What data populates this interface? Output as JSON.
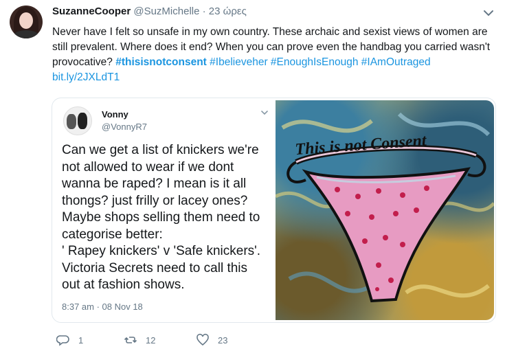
{
  "tweet": {
    "display_name": "SuzanneCooper",
    "handle": "@SuzMichelle",
    "separator": "·",
    "time": "23 ώρες",
    "text_plain": "Never have I felt so unsafe in my own country. These archaic and sexist views of women are still prevalent. Where does it end? When you can prove even the handbag you carried wasn't provocative?",
    "hashtags": [
      "#thisisnotconsent",
      "#Ibelieveher",
      "#EnoughIsEnough",
      "#IAmOutraged"
    ],
    "link": "bit.ly/2JXLdT1"
  },
  "quoted": {
    "display_name": "Vonny",
    "handle": "@VonnyR7",
    "text": "Can we get a list of knickers we're\nnot allowed to wear if we dont\nwanna be raped? I mean is it all\nthongs? just frilly or lacey ones?\nMaybe shops selling them need to\ncategorise better:\n' Rapey knickers' v 'Safe knickers'.\nVictoria Secrets need to call this\nout at fashion shows.",
    "timestamp": "8:37 am · 08 Nov 18",
    "image_caption": "This is not Consent"
  },
  "actions": {
    "reply_count": "1",
    "retweet_count": "12",
    "like_count": "23"
  },
  "colors": {
    "link": "#1b95e0",
    "muted": "#657786",
    "text": "#14171a",
    "border": "#e1e8ed"
  },
  "icons": [
    "chevron-down-icon",
    "reply-icon",
    "retweet-icon",
    "like-icon"
  ]
}
